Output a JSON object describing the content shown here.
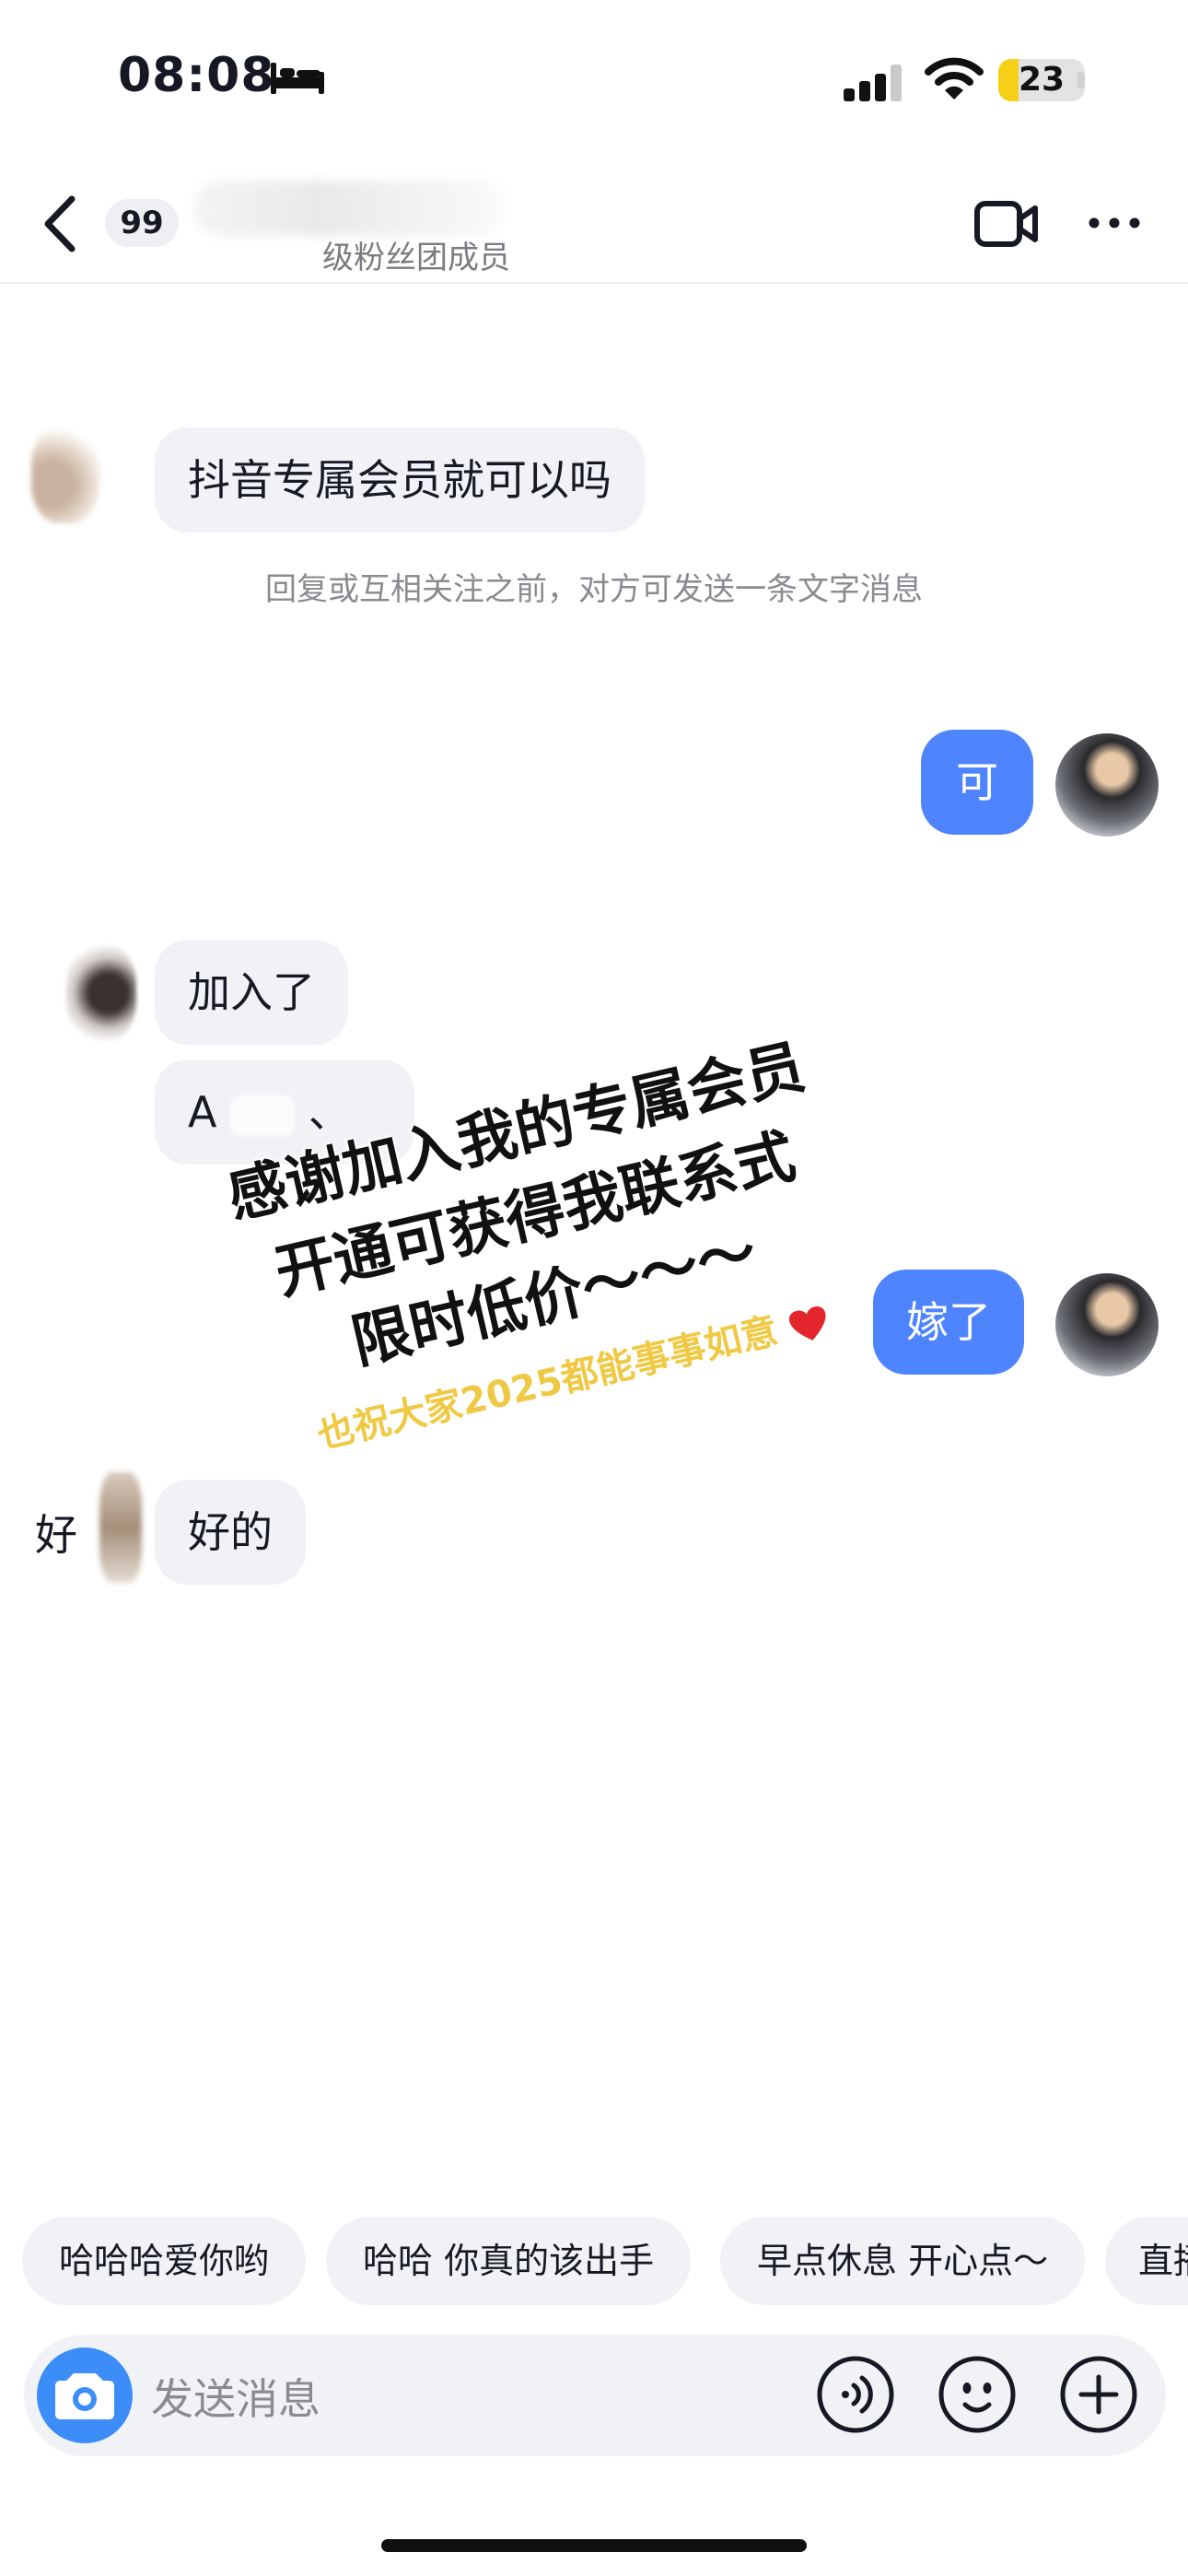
{
  "status_bar": {
    "time": "08:08",
    "battery": "23",
    "battery_level": 0.23
  },
  "header": {
    "unread_count": "99",
    "subtitle": "级粉丝团成员"
  },
  "messages": [
    {
      "side": "in",
      "text": "抖音专属会员就可以吗"
    },
    {
      "side": "out",
      "text": "可"
    },
    {
      "side": "in",
      "text": "加入了"
    },
    {
      "side": "in",
      "text_before": "A",
      "text_after": "、"
    },
    {
      "side": "out",
      "text": "嫁了"
    },
    {
      "side": "in",
      "text": "好的",
      "prefix": "好"
    }
  ],
  "notice": "回复或互相关注之前，对方可发送一条文字消息",
  "overlay": {
    "line1": "感谢加入我的专属会员",
    "line2": "开通可获得我联系式",
    "line3": "限时低价～～～",
    "line4": "也祝大家2025都能事事如意"
  },
  "quick_replies": [
    "哈哈哈爱你哟",
    "哈哈 你真的该出手",
    "早点休息 开心点～",
    "直播"
  ],
  "input": {
    "placeholder": "发送消息"
  },
  "icons": {
    "back": "chevron-left-icon",
    "video": "video-call-icon",
    "more": "more-dots-icon",
    "camera": "camera-icon",
    "voice": "voice-icon",
    "emoji": "emoji-icon",
    "add": "plus-icon",
    "heart": "heart-icon"
  },
  "colors": {
    "outgoing_bubble": "#4f84ff",
    "incoming_bubble": "#f1f2f5",
    "camera_button": "#3c8df8",
    "overlay_yellow": "#f0c944",
    "battery_fill": "#f7cf16"
  }
}
